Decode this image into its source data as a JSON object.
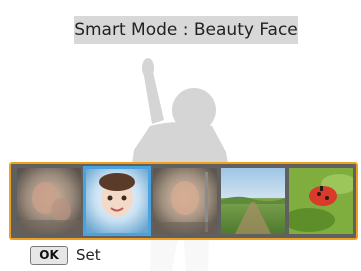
{
  "screen": {
    "title": "Smart Mode : Beauty Face",
    "background_color": "#ffffff"
  },
  "thumbnails": [
    {
      "scene": "beauty-face-a",
      "selected": false
    },
    {
      "scene": "beauty-face-b",
      "selected": true
    },
    {
      "scene": "beauty-face-c",
      "selected": false
    },
    {
      "scene": "landscape",
      "selected": false
    },
    {
      "scene": "macro-flower",
      "selected": false
    }
  ],
  "footer": {
    "ok_key": "OK",
    "action_label": "Set"
  },
  "colors": {
    "strip_border": "#f0a020",
    "selection": "#4aa3df",
    "title_background": "#d8d8d8"
  }
}
